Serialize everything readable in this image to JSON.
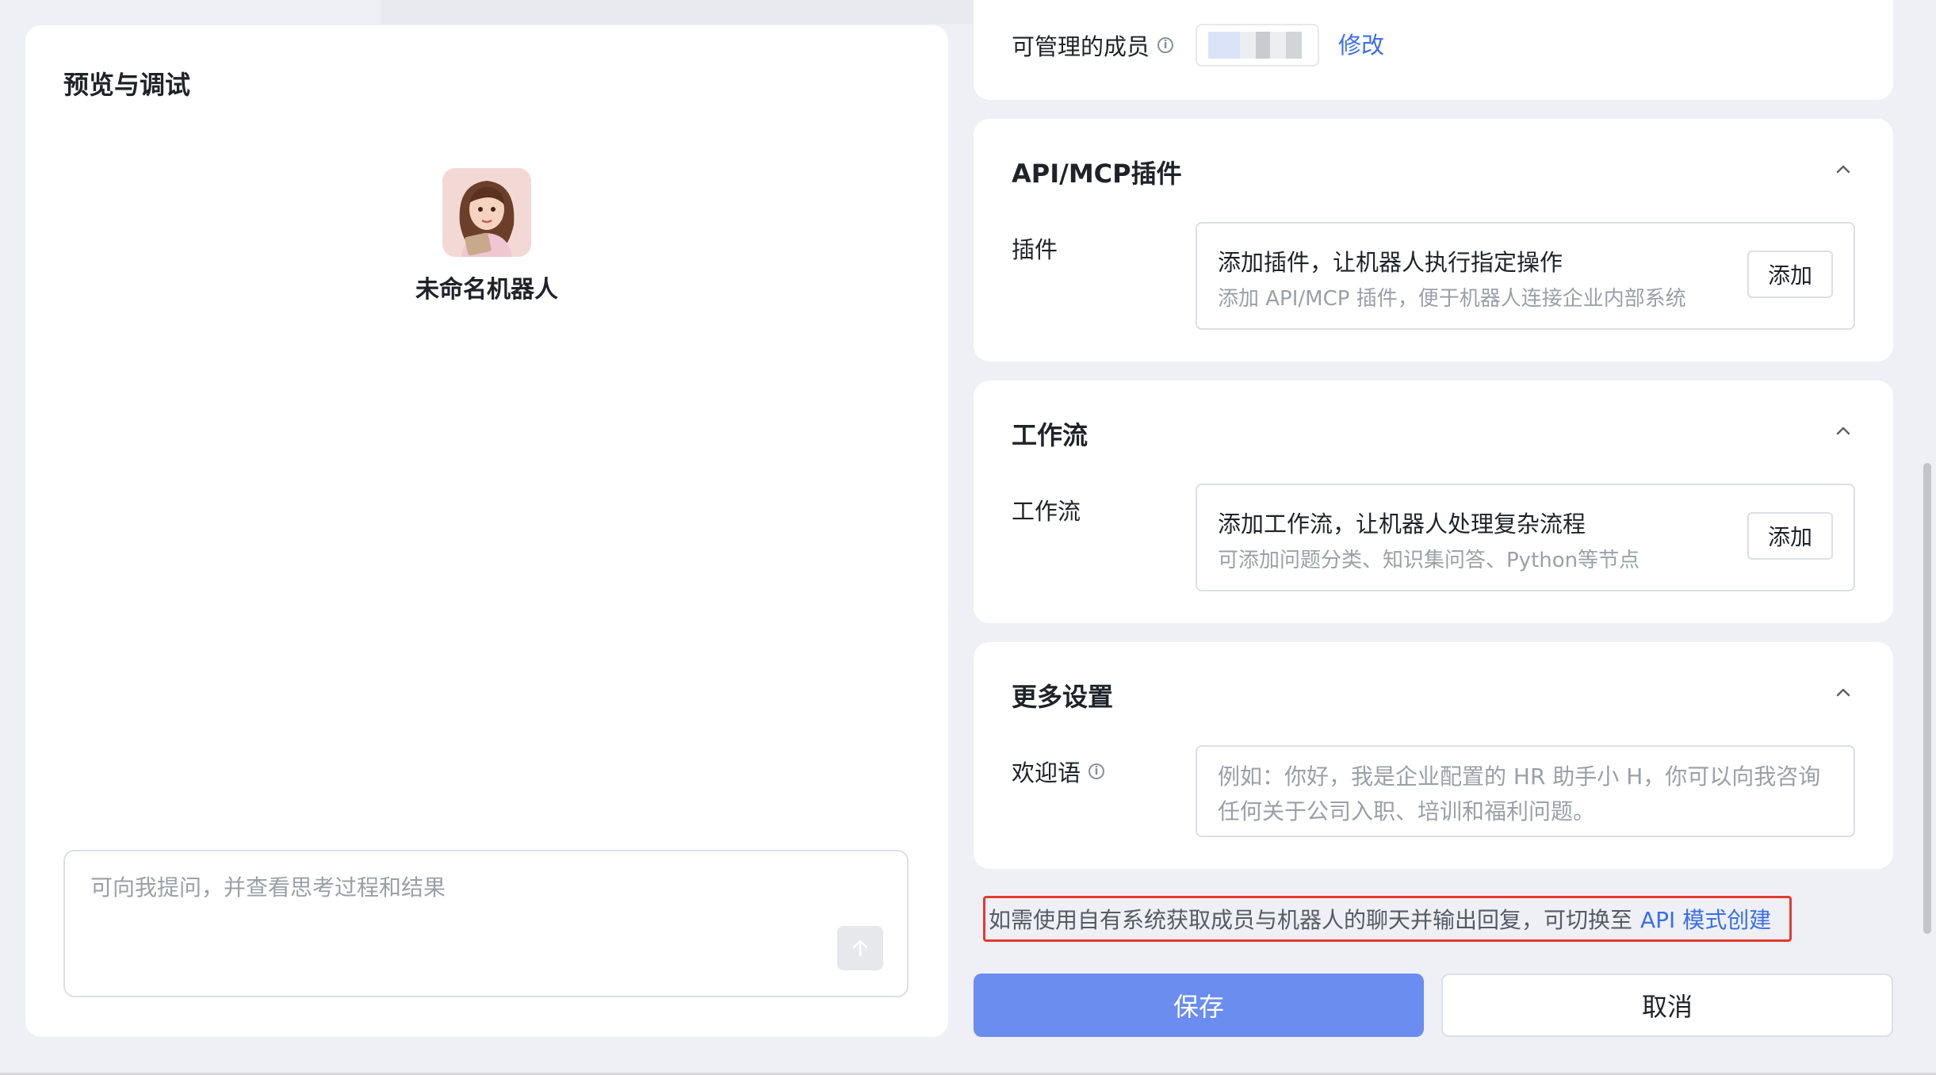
{
  "preview": {
    "title": "预览与调试",
    "bot_name": "未命名机器人",
    "chat_placeholder": "可向我提问，并查看思考过程和结果"
  },
  "members": {
    "label": "可管理的成员",
    "edit_label": "修改"
  },
  "plugins_card": {
    "title": "API/MCP插件",
    "field_label": "插件",
    "box_title": "添加插件，让机器人执行指定操作",
    "box_desc": "添加 API/MCP 插件，便于机器人连接企业内部系统",
    "add_label": "添加"
  },
  "workflow_card": {
    "title": "工作流",
    "field_label": "工作流",
    "box_title": "添加工作流，让机器人处理复杂流程",
    "box_desc": "可添加问题分类、知识集问答、Python等节点",
    "add_label": "添加"
  },
  "more_card": {
    "title": "更多设置",
    "welcome_label": "欢迎语",
    "welcome_placeholder": "例如：你好，我是企业配置的 HR 助手小 H，你可以向我咨询任何关于公司入职、培训和福利问题。"
  },
  "notice": {
    "text": "如需使用自有系统获取成员与机器人的聊天并输出回复，可切换至",
    "link": "API 模式创建"
  },
  "actions": {
    "save": "保存",
    "cancel": "取消"
  },
  "colors": {
    "primary": "#6b8def",
    "link": "#3a6ee8",
    "highlight_border": "#e23a2e"
  }
}
